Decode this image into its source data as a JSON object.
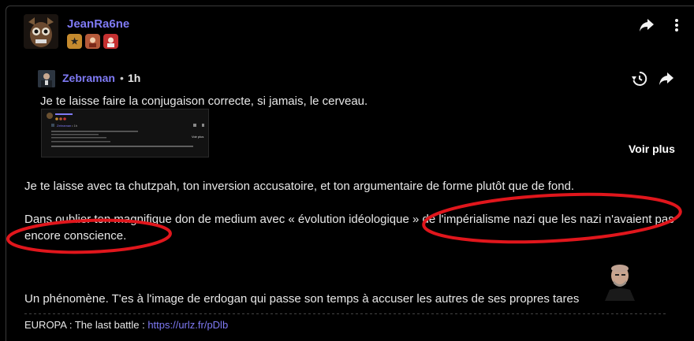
{
  "post": {
    "author": "JeanRa6ne",
    "badges": [
      {
        "name": "star-badge",
        "glyph": "★"
      },
      {
        "name": "avatar-badge-1",
        "glyph": ""
      },
      {
        "name": "avatar-badge-2",
        "glyph": ""
      }
    ],
    "share_icon": "share-icon",
    "menu_icon": "more-vertical-icon"
  },
  "quote": {
    "author": "Zebraman",
    "separator": "•",
    "time": "1h",
    "text": "Je te laisse faire la conjugaison correcte, si jamais, le cerveau.",
    "history_icon": "history-icon",
    "share_icon": "share-icon",
    "thumbnail": {
      "author": "Zebraman",
      "time": "1h",
      "more": "Voir plus"
    },
    "more_label": "Voir plus"
  },
  "body": {
    "p1": "Je te laisse avec ta chutzpah, ton inversion accusatoire, et ton argumentaire de forme plutôt que de fond.",
    "p2": "Dans oublier ton magnifique don de medium avec « évolution idéologique » de l'impérialisme nazi que les nazi n'avaient pas encore conscience.",
    "p3": "Un phénomène. T'es à l'image de erdogan qui passe son temps à accuser les autres de ses propres tares"
  },
  "signature": {
    "label": "EUROPA : The last battle : ",
    "link": "https://urlz.fr/pDlb"
  },
  "colors": {
    "username": "#7f7af5",
    "annotation": "#e0161c",
    "background": "#000000"
  }
}
